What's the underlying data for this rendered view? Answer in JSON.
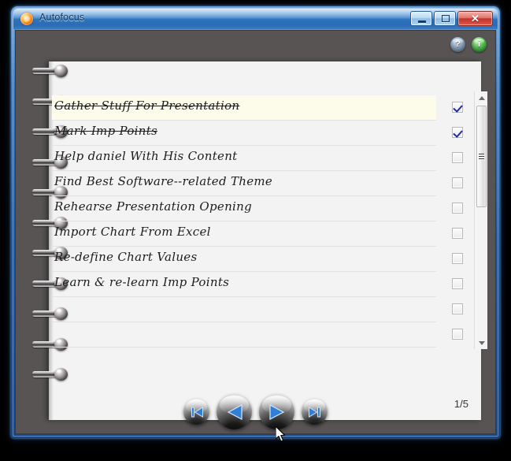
{
  "window": {
    "title": "Autofocus",
    "icon": "autofocus-app-icon",
    "controls": {
      "minimize_label": "–",
      "maximize_label": "□",
      "close_label": "✕"
    }
  },
  "toolbar": {
    "help_label": "?",
    "info_label": "i"
  },
  "list": {
    "items": [
      {
        "text": "Gather Stuff For Presentation",
        "checked": true,
        "done": true,
        "highlight": true
      },
      {
        "text": "Mark Imp Points",
        "checked": true,
        "done": true,
        "highlight": false
      },
      {
        "text": "Help daniel With His Content",
        "checked": false,
        "done": false,
        "highlight": false
      },
      {
        "text": "Find Best Software--related Theme",
        "checked": false,
        "done": false,
        "highlight": false
      },
      {
        "text": "Rehearse  Presentation Opening",
        "checked": false,
        "done": false,
        "highlight": false
      },
      {
        "text": "Import Chart From Excel",
        "checked": false,
        "done": false,
        "highlight": false
      },
      {
        "text": "Re-define Chart Values",
        "checked": false,
        "done": false,
        "highlight": false
      },
      {
        "text": "Learn & re-learn Imp Points",
        "checked": false,
        "done": false,
        "highlight": false
      },
      {
        "text": "",
        "checked": false,
        "done": false,
        "highlight": false
      },
      {
        "text": "",
        "checked": false,
        "done": false,
        "highlight": false
      }
    ]
  },
  "scrollbar": {
    "up_arrow": "scroll-up-arrow",
    "down_arrow": "scroll-down-arrow"
  },
  "status": {
    "page_counter": "1/5"
  },
  "navigation": {
    "first_label": "first-page",
    "previous_label": "previous-page",
    "next_label": "next-page",
    "last_label": "last-page"
  },
  "colors": {
    "frame_blue": "#205aa5",
    "client_gray": "#585454",
    "page_white": "#f3f3f3",
    "highlight_yellow": "#fdfcea",
    "check_blue": "#1d2f9c",
    "nav_blue": "#2f7fd8",
    "info_green": "#5dc357"
  }
}
